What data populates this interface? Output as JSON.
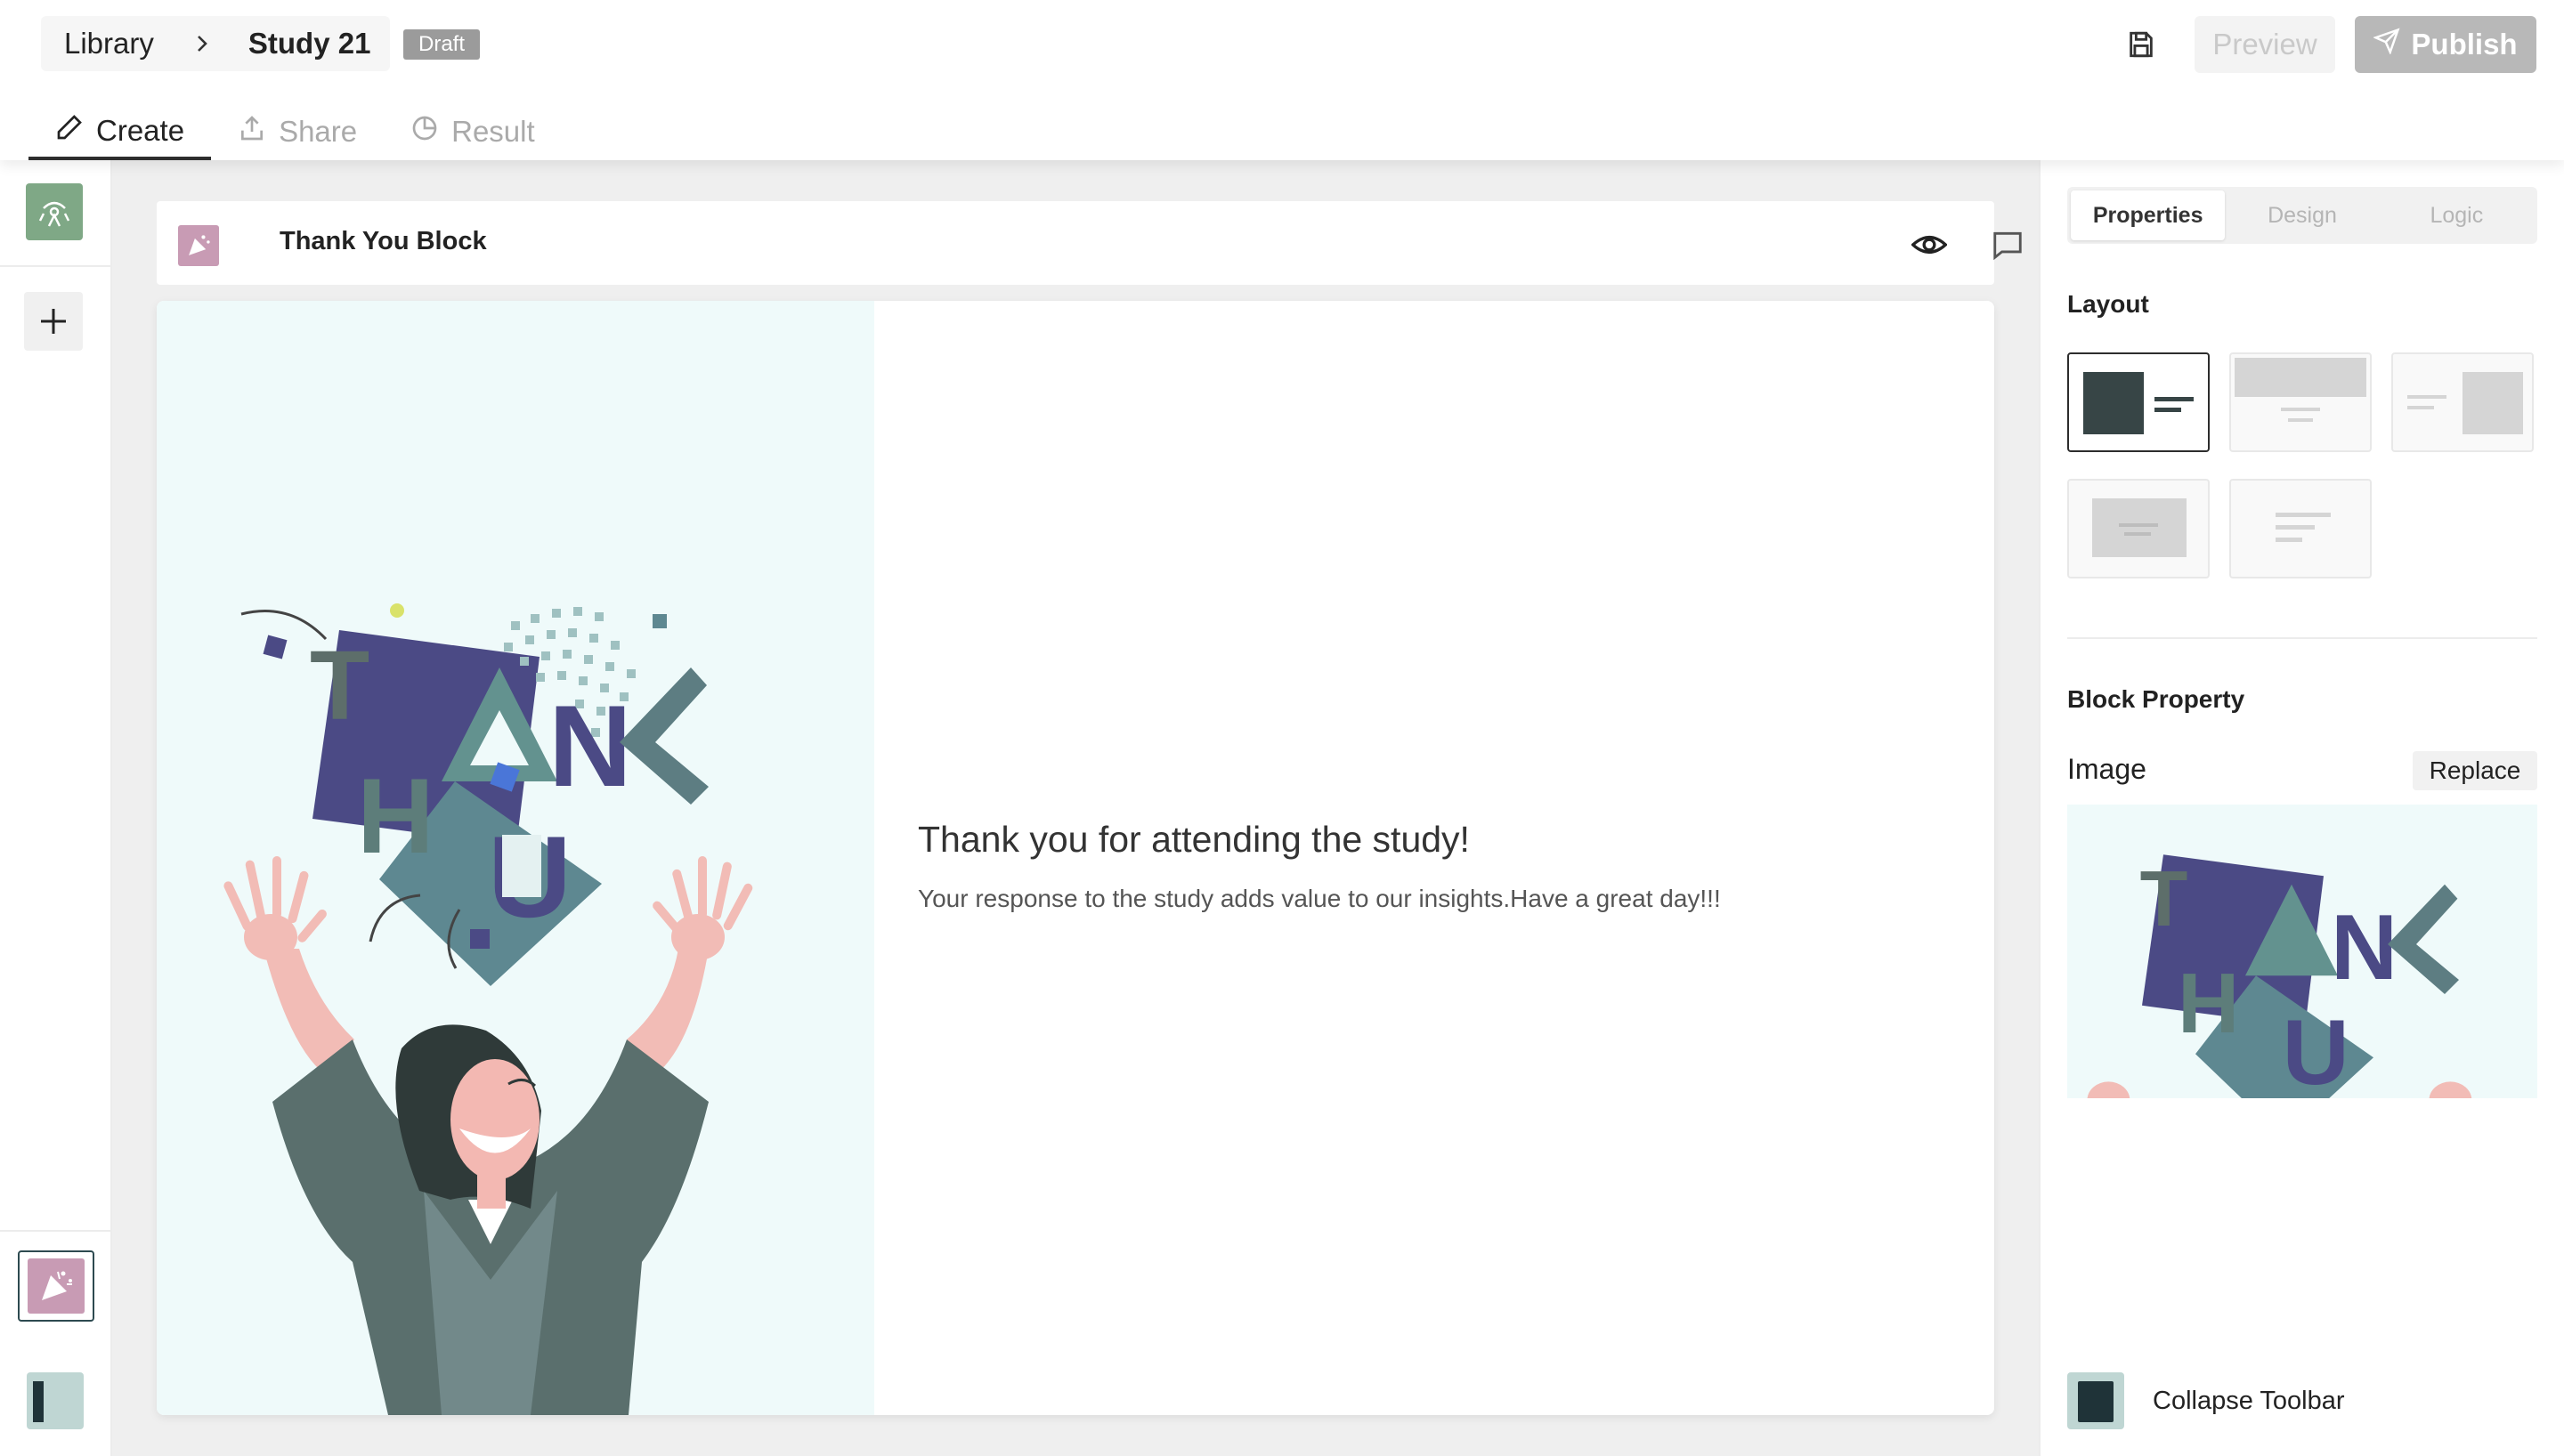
{
  "header": {
    "breadcrumb_root": "Library",
    "breadcrumb_current": "Study 21",
    "status_badge": "Draft",
    "preview_label": "Preview",
    "publish_label": "Publish"
  },
  "tabs": [
    {
      "label": "Create",
      "icon": "pencil-icon",
      "active": true
    },
    {
      "label": "Share",
      "icon": "upload-icon",
      "active": false
    },
    {
      "label": "Result",
      "icon": "pie-chart-icon",
      "active": false
    }
  ],
  "block": {
    "title": "Thank You Block",
    "heading": "Thank you for attending the study!",
    "description": "Your response to the study adds value to our insights.Have a great day!!!"
  },
  "panel": {
    "tabs": [
      {
        "label": "Properties",
        "active": true
      },
      {
        "label": "Design",
        "active": false
      },
      {
        "label": "Logic",
        "active": false
      }
    ],
    "layout_title": "Layout",
    "block_property_title": "Block Property",
    "image_label": "Image",
    "replace_label": "Replace",
    "collapse_label": "Collapse Toolbar"
  },
  "colors": {
    "accent_dark": "#2d2d2d",
    "thank_you_icon": "#c89bb4",
    "logo_green": "#7fa886",
    "illustration_bg": "#effafa"
  }
}
